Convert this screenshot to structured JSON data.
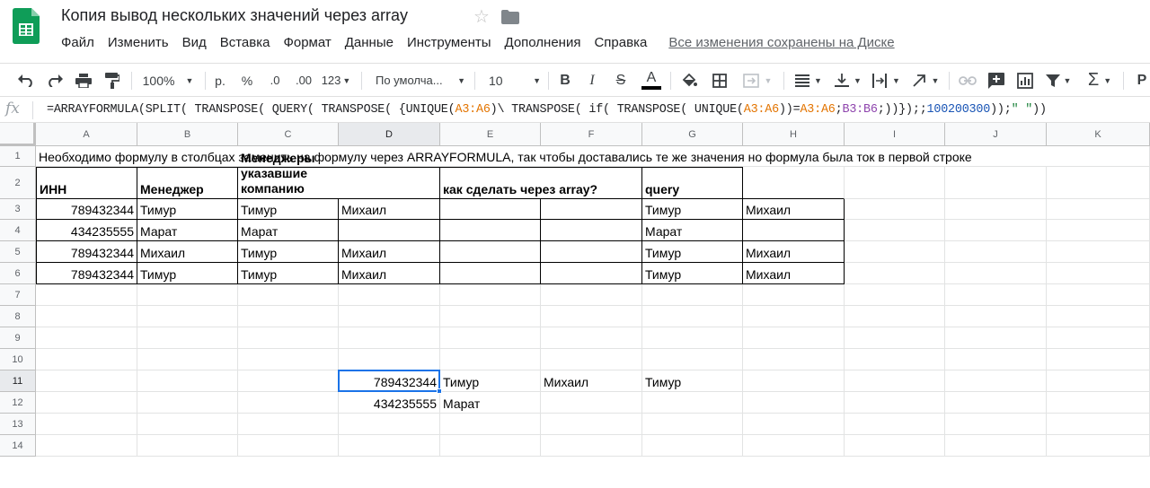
{
  "doc": {
    "title": "Копия вывод нескольких значений через array"
  },
  "menu": {
    "items": [
      "Файл",
      "Изменить",
      "Вид",
      "Вставка",
      "Формат",
      "Данные",
      "Инструменты",
      "Дополнения",
      "Справка"
    ],
    "saved_status": "Все изменения сохранены на Диске"
  },
  "toolbar": {
    "zoom": "100%",
    "currency": "р.",
    "percent": "%",
    "dec_less": ".0",
    "dec_more": ".00",
    "format_more": "123",
    "font": "По умолча...",
    "font_size": "10",
    "bold": "B",
    "italic": "I",
    "strike": "S",
    "text_color": "A",
    "overflow_label": "Р"
  },
  "formula_bar": {
    "fx": "fx",
    "parts": [
      {
        "t": "=ARRAYFORMULA(SPLIT( TRANSPOSE( QUERY( TRANSPOSE(  {UNIQUE(",
        "c": "#202124"
      },
      {
        "t": "A3:A6",
        "c": "#e37400"
      },
      {
        "t": ")\\ TRANSPOSE( if( TRANSPOSE( UNIQUE(",
        "c": "#202124"
      },
      {
        "t": "A3:A6",
        "c": "#e37400"
      },
      {
        "t": "))=",
        "c": "#202124"
      },
      {
        "t": "A3:A6",
        "c": "#e37400"
      },
      {
        "t": ";",
        "c": "#202124"
      },
      {
        "t": "B3:B6",
        "c": "#8e44ad"
      },
      {
        "t": ";))});;",
        "c": "#202124"
      },
      {
        "t": "100200300",
        "c": "#1a55b5"
      },
      {
        "t": "));",
        "c": "#202124"
      },
      {
        "t": "\" \"",
        "c": "#188038"
      },
      {
        "t": "))",
        "c": "#202124"
      }
    ]
  },
  "columns": [
    "A",
    "B",
    "C",
    "D",
    "E",
    "F",
    "G",
    "H",
    "I",
    "J",
    "K"
  ],
  "rows": [
    "1",
    "2",
    "3",
    "4",
    "5",
    "6",
    "7",
    "8",
    "9",
    "10",
    "11",
    "12",
    "13",
    "14"
  ],
  "cells": {
    "r1": "Необходимо формулу в столбцах заменить на формулу через ARRAYFORMULA, так чтобы доставались те же значения но формула была ток в первой строке",
    "r2": {
      "A": "ИНН",
      "B": "Менеджер",
      "C": "Менеджеры указавшие компанию",
      "E": "как сделать через array?",
      "G": "query"
    },
    "r3": {
      "A": "789432344",
      "B": "Тимур",
      "C": "Тимур",
      "D": "Михаил",
      "G": "Тимур",
      "H": "Михаил"
    },
    "r4": {
      "A": "434235555",
      "B": "Марат",
      "C": "Марат",
      "G": "Марат"
    },
    "r5": {
      "A": "789432344",
      "B": "Михаил",
      "C": "Тимур",
      "D": "Михаил",
      "G": "Тимур",
      "H": "Михаил"
    },
    "r6": {
      "A": "789432344",
      "B": "Тимур",
      "C": "Тимур",
      "D": "Михаил",
      "G": "Тимур",
      "H": "Михаил"
    },
    "r11": {
      "D": "789432344",
      "E": "Тимур",
      "F": "Михаил",
      "G": "Тимур"
    },
    "r12": {
      "D": "434235555",
      "E": "Марат"
    }
  },
  "colors": {
    "selection": "#1a73e8",
    "sheets_green": "#0f9d58",
    "range_orange": "#e37400",
    "range_purple": "#8e44ad"
  }
}
